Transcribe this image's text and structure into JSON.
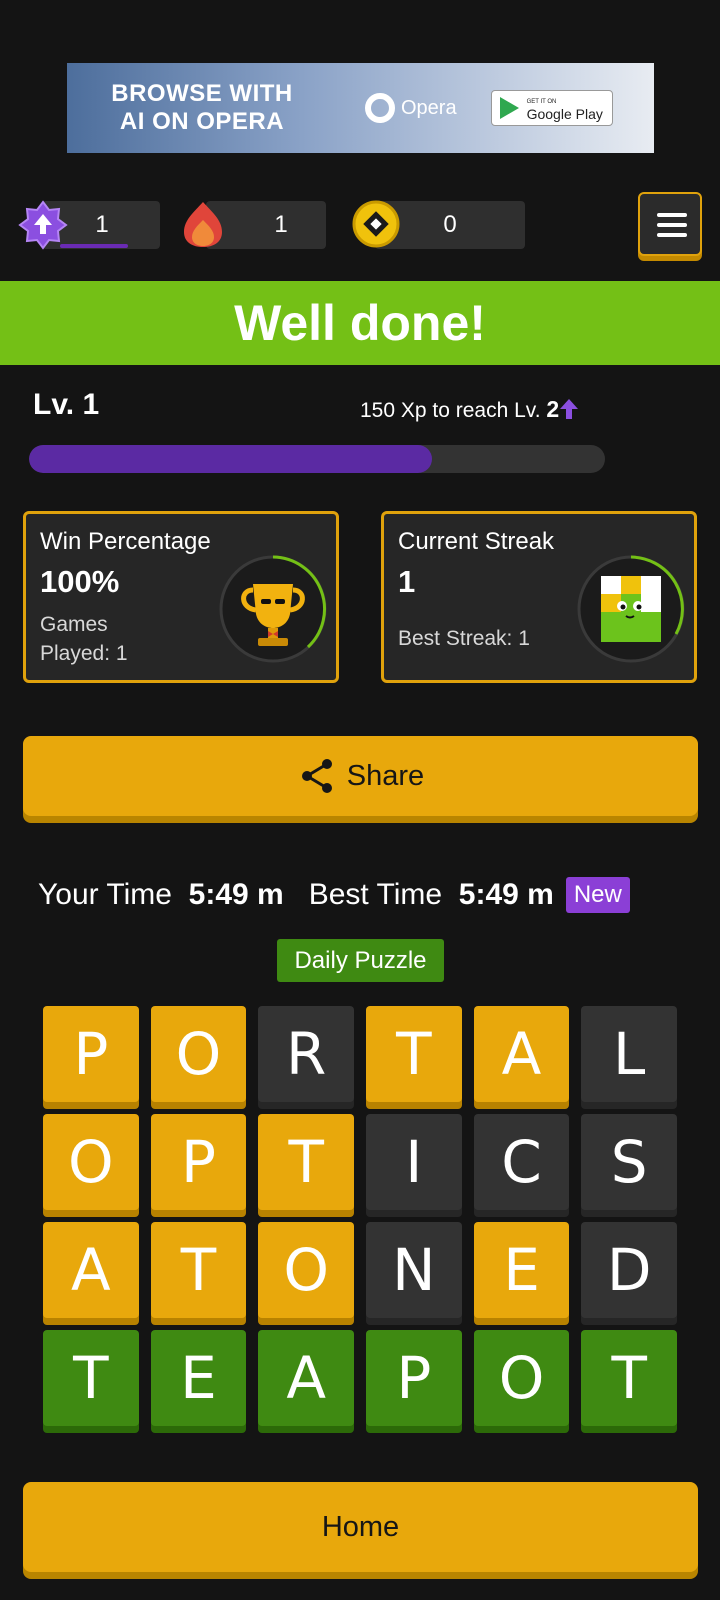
{
  "ad": {
    "headline_line1": "BROWSE WITH",
    "headline_line2": "AI ON OPERA",
    "brand": "Opera",
    "store_small": "GET IT ON",
    "store_big": "Google Play"
  },
  "top_stats": {
    "xp_level": "1",
    "streak": "1",
    "coins": "0"
  },
  "banner": {
    "text": "Well done!"
  },
  "level": {
    "label": "Lv. 1",
    "xp_prefix": "150 Xp to reach Lv. ",
    "next_level": "2",
    "progress": 0.7
  },
  "cards": {
    "win": {
      "title": "Win Percentage",
      "value": "100%",
      "sub_line1": "Games",
      "sub_line2": "Played: 1"
    },
    "streak": {
      "title": "Current Streak",
      "value": "1",
      "sub_line1": "Best Streak: 1"
    }
  },
  "share": {
    "label": "Share"
  },
  "times": {
    "your_label": "Your Time",
    "your_value": "5:49 m",
    "best_label": "Best Time",
    "best_value": "5:49 m",
    "badge": "New"
  },
  "daily": {
    "label": "Daily Puzzle"
  },
  "grid": [
    [
      {
        "l": "P",
        "s": "present"
      },
      {
        "l": "O",
        "s": "present"
      },
      {
        "l": "R",
        "s": "absent"
      },
      {
        "l": "T",
        "s": "present"
      },
      {
        "l": "A",
        "s": "present"
      },
      {
        "l": "L",
        "s": "absent"
      }
    ],
    [
      {
        "l": "O",
        "s": "present"
      },
      {
        "l": "P",
        "s": "present"
      },
      {
        "l": "T",
        "s": "present"
      },
      {
        "l": "I",
        "s": "absent"
      },
      {
        "l": "C",
        "s": "absent"
      },
      {
        "l": "S",
        "s": "absent"
      }
    ],
    [
      {
        "l": "A",
        "s": "present"
      },
      {
        "l": "T",
        "s": "present"
      },
      {
        "l": "O",
        "s": "present"
      },
      {
        "l": "N",
        "s": "absent"
      },
      {
        "l": "E",
        "s": "present"
      },
      {
        "l": "D",
        "s": "absent"
      }
    ],
    [
      {
        "l": "T",
        "s": "correct"
      },
      {
        "l": "E",
        "s": "correct"
      },
      {
        "l": "A",
        "s": "correct"
      },
      {
        "l": "P",
        "s": "correct"
      },
      {
        "l": "O",
        "s": "correct"
      },
      {
        "l": "T",
        "s": "correct"
      }
    ]
  ],
  "home": {
    "label": "Home"
  },
  "colors": {
    "accent": "#e8a80c",
    "success": "#74c016",
    "tile_correct": "#3f8a12",
    "xp": "#5b2aa3"
  },
  "icons": {
    "xp": "xp-star-icon",
    "streak": "flame-icon",
    "coins": "coin-icon",
    "menu": "hamburger-menu-icon",
    "share": "share-icon"
  }
}
